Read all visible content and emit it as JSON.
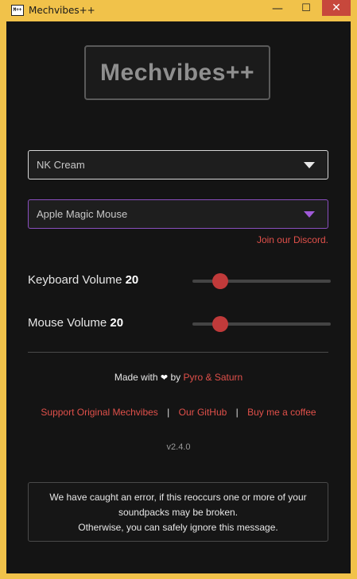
{
  "window": {
    "title": "Mechvibes++",
    "icon_text": "M++",
    "controls": {
      "minimize": "—",
      "maximize": "☐",
      "close": "✕"
    }
  },
  "app": {
    "logo_text": "Mechvibes++",
    "keyboard_pack": {
      "selected": "NK Cream"
    },
    "mouse_pack": {
      "selected": "Apple Magic Mouse"
    },
    "discord_link": "Join our Discord.",
    "keyboard_volume": {
      "label": "Keyboard Volume",
      "value": "20",
      "fraction": 0.2
    },
    "mouse_volume": {
      "label": "Mouse Volume",
      "value": "20",
      "fraction": 0.2
    },
    "footer": {
      "made_with": "Made with",
      "heart": "❤",
      "by": "by",
      "authors": "Pyro & Saturn",
      "links": [
        "Support Original Mechvibes",
        "Our GitHub",
        "Buy me a coffee"
      ],
      "separator": "|",
      "version": "v2.4.0"
    },
    "error_message": {
      "line1": "We have caught an error, if this reoccurs one or more of your",
      "line2": "soundpacks may be broken.",
      "line3": "Otherwise, you can safely ignore this message."
    }
  },
  "colors": {
    "titlebar": "#f1c24a",
    "background": "#141414",
    "accent_red": "#e0504a",
    "slider_thumb": "#c03a3a",
    "mouse_select_border": "#8a4fbf"
  }
}
